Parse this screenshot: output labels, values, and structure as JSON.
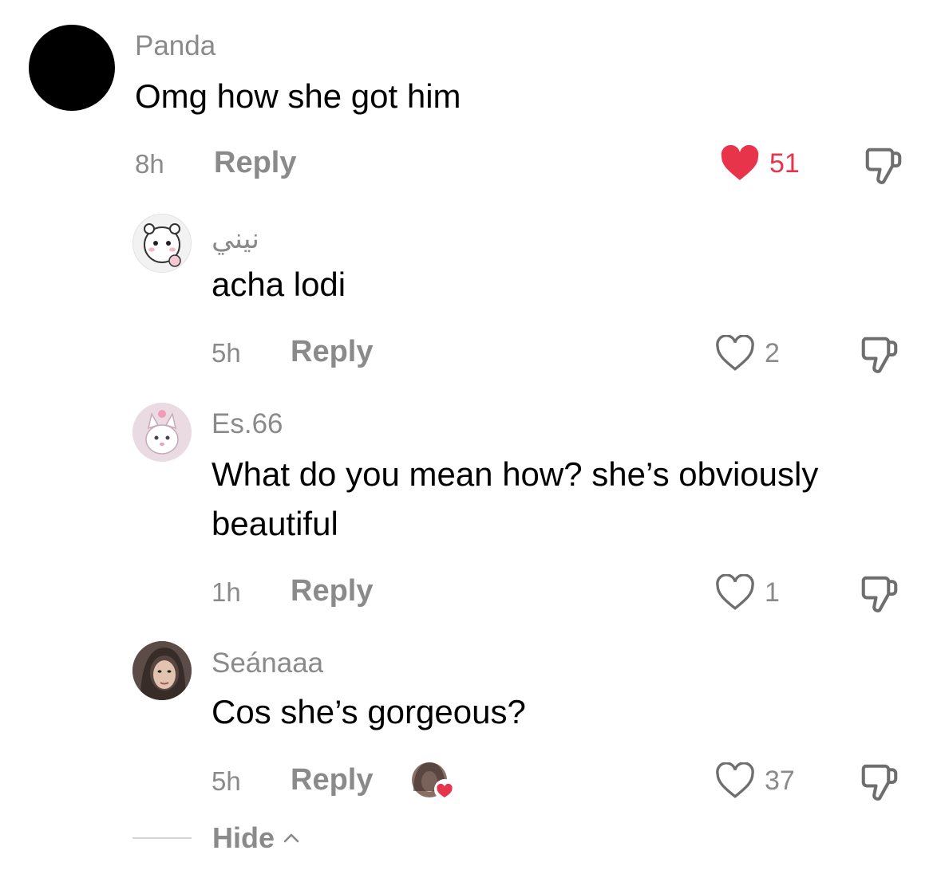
{
  "comments": [
    {
      "username": "Panda",
      "text": "Omg how she got him",
      "time": "8h",
      "reply_label": "Reply",
      "likes": "51",
      "liked": true
    },
    {
      "username": "نيني",
      "text": "acha lodi",
      "time": "5h",
      "reply_label": "Reply",
      "likes": "2",
      "liked": false
    },
    {
      "username": "Es.66",
      "text_line1": "What do you mean how? she’s obviously",
      "text_line2": "beautiful",
      "time": "1h",
      "reply_label": "Reply",
      "likes": "1",
      "liked": false
    },
    {
      "username": "Seánaaa",
      "text": "Cos she’s gorgeous?",
      "time": "5h",
      "reply_label": "Reply",
      "likes": "37",
      "liked": false,
      "creator_liked": true
    }
  ],
  "hide_label": "Hide",
  "icons": {
    "like_filled": "heart-filled-icon",
    "like_outline": "heart-outline-icon",
    "dislike": "thumbs-down-icon",
    "hide_chevron": "chevron-up-icon"
  },
  "colors": {
    "like_red": "#e8344b",
    "secondary_text": "#8a8a8a",
    "primary_text": "#000000"
  }
}
